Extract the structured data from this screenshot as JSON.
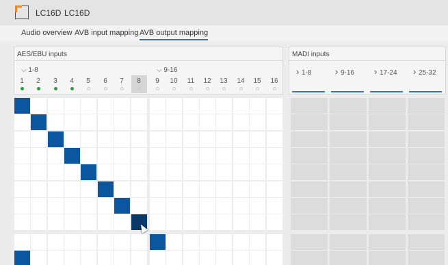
{
  "app": {
    "device_name": "LC16D",
    "device_label": "LC16D"
  },
  "tabs": [
    {
      "label": "Audio overview",
      "active": false
    },
    {
      "label": "AVB input mapping",
      "active": false
    },
    {
      "label": "AVB output mapping",
      "active": true
    }
  ],
  "aes": {
    "title": "AES/EBU inputs",
    "groups": [
      {
        "label": "1-8",
        "expanded": true
      },
      {
        "label": "9-16",
        "expanded": true
      }
    ],
    "columns": [
      "1",
      "2",
      "3",
      "4",
      "5",
      "6",
      "7",
      "8",
      "9",
      "10",
      "11",
      "12",
      "13",
      "14",
      "15",
      "16"
    ],
    "signal": [
      true,
      true,
      true,
      true,
      false,
      false,
      false,
      false,
      false,
      false,
      false,
      false,
      false,
      false,
      false,
      false
    ],
    "highlighted_column": "8"
  },
  "madi": {
    "title": "MADI inputs",
    "groups": [
      {
        "label": "1-8",
        "expanded": false
      },
      {
        "label": "9-16",
        "expanded": false
      },
      {
        "label": "17-24",
        "expanded": false
      },
      {
        "label": "25-32",
        "expanded": false
      }
    ]
  },
  "matrix": {
    "rows_visible": 10,
    "connections": [
      {
        "row": 0,
        "col": 0
      },
      {
        "row": 1,
        "col": 1
      },
      {
        "row": 2,
        "col": 2
      },
      {
        "row": 3,
        "col": 3
      },
      {
        "row": 4,
        "col": 4
      },
      {
        "row": 5,
        "col": 5
      },
      {
        "row": 6,
        "col": 6
      },
      {
        "row": 7,
        "col": 7,
        "hover": true
      },
      {
        "row": 8,
        "col": 8
      },
      {
        "row": 9,
        "col": 0
      }
    ]
  },
  "colors": {
    "connected": "#0c56a0",
    "hover": "#0b3a6a",
    "signal_on": "#2a9d3a",
    "accent": "#3b6fb0",
    "brand": "#e08a2c"
  },
  "icons": {
    "expanded": "chevron-down-icon",
    "collapsed": "chevron-right-icon"
  }
}
